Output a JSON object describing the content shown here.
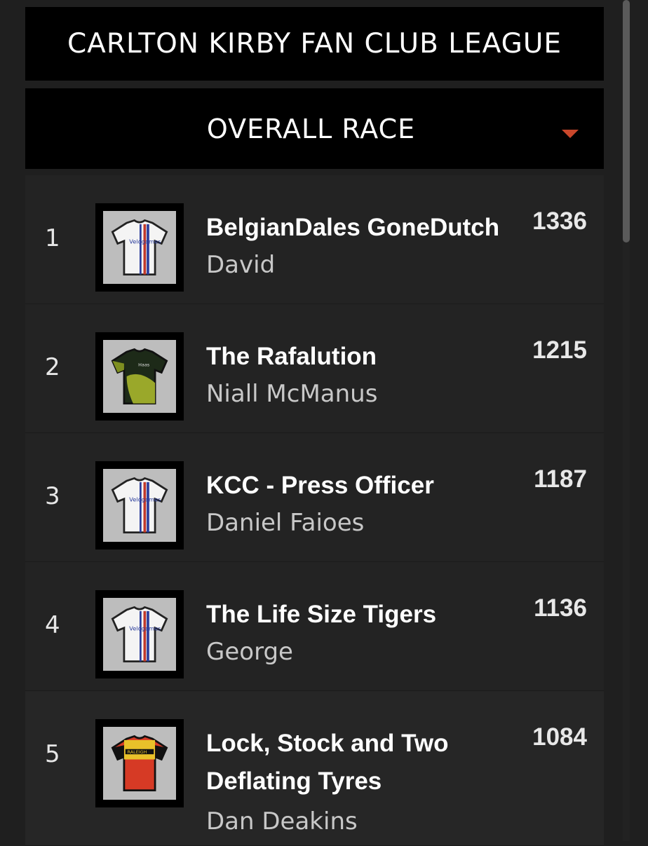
{
  "league": {
    "title": "CARLTON KIRBY FAN CLUB LEAGUE"
  },
  "race_selector": {
    "selected": "OVERALL RACE",
    "caret_color": "#c9472b"
  },
  "standings": [
    {
      "rank": "1",
      "team": "BelgianDales GoneDutch",
      "manager": "David",
      "points": "1336",
      "jersey": "velogames-white"
    },
    {
      "rank": "2",
      "team": "The Rafalution",
      "manager": "Niall McManus",
      "points": "1215",
      "jersey": "black-green"
    },
    {
      "rank": "3",
      "team": "KCC - Press Officer",
      "manager": "Daniel Faioes",
      "points": "1187",
      "jersey": "velogames-white"
    },
    {
      "rank": "4",
      "team": "The Life Size Tigers",
      "manager": "George",
      "points": "1136",
      "jersey": "velogames-white"
    },
    {
      "rank": "5",
      "team": "Lock, Stock and Two Deflating Tyres",
      "manager": "Dan Deakins",
      "points": "1084",
      "jersey": "raleigh-red-yellow"
    }
  ]
}
